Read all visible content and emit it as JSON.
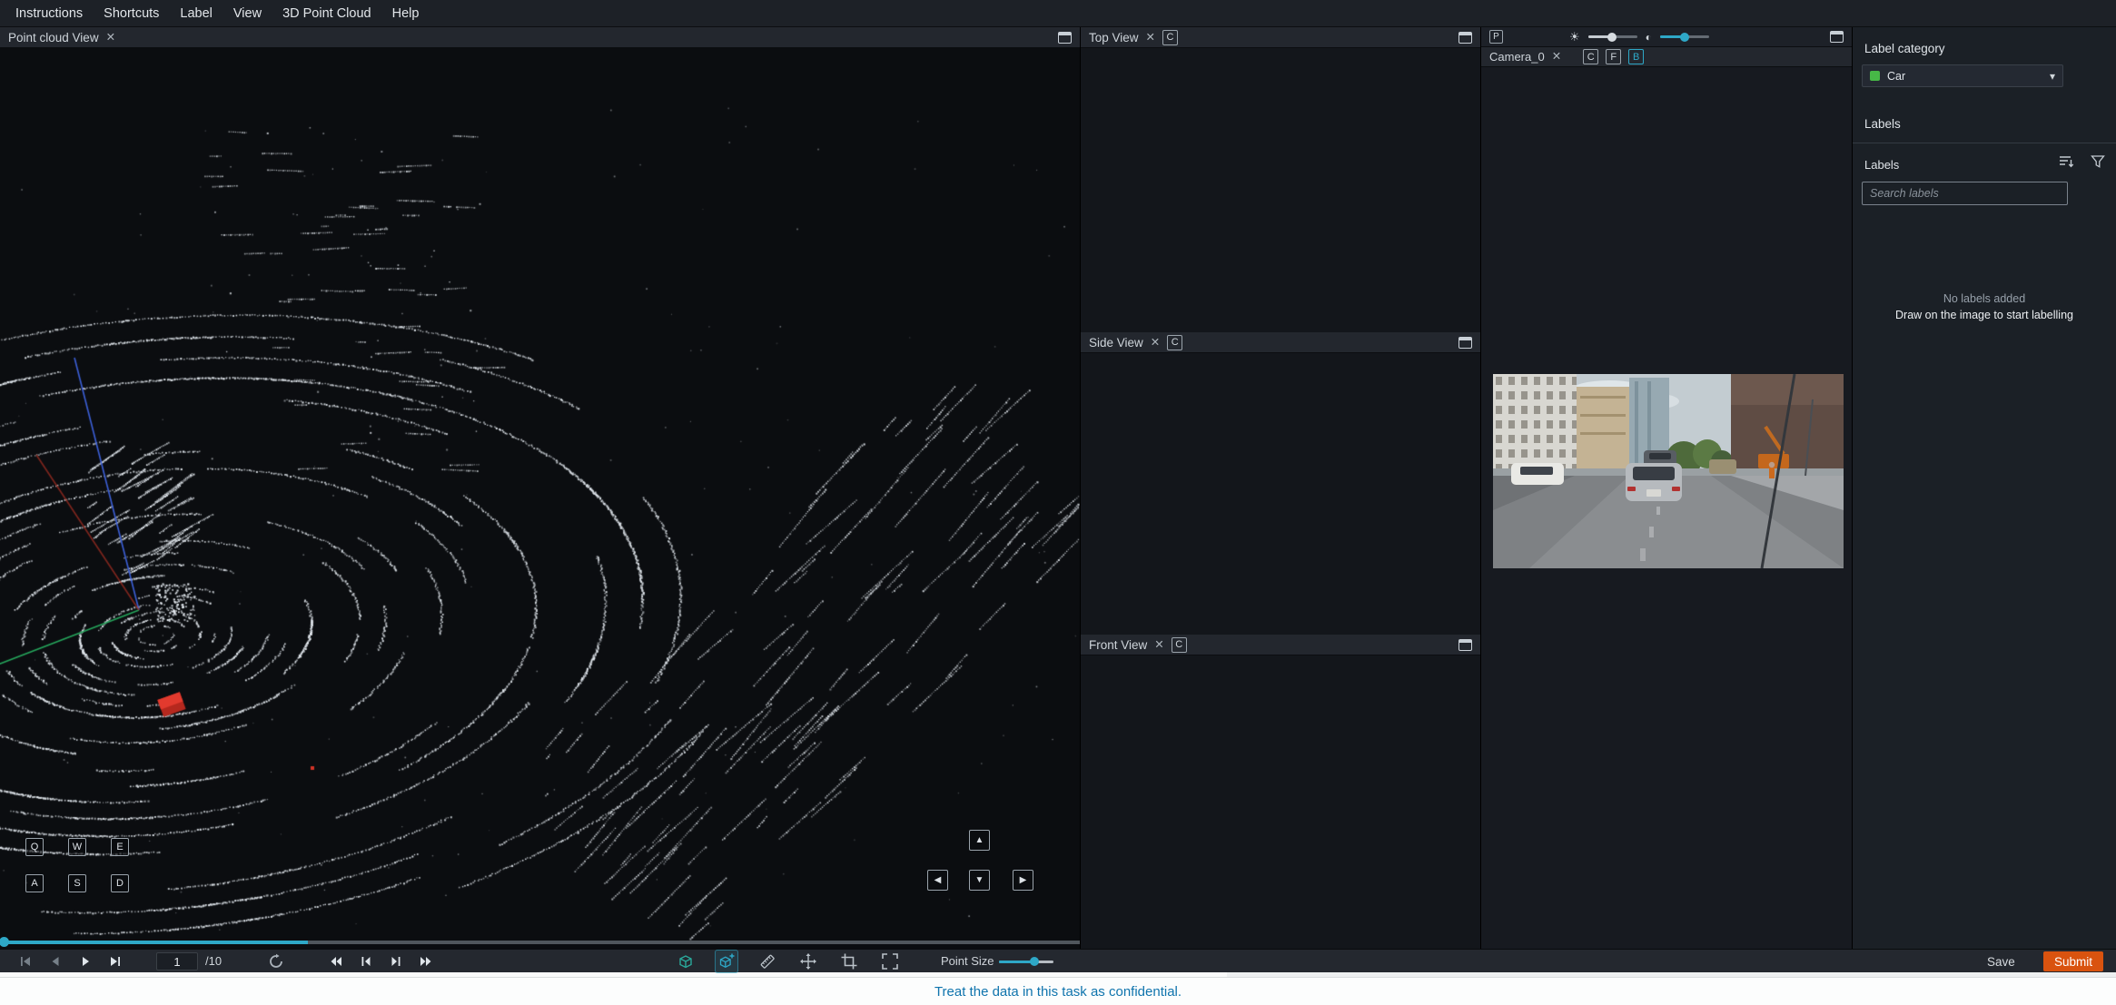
{
  "menu": {
    "items": [
      "Instructions",
      "Shortcuts",
      "Label",
      "View",
      "3D Point Cloud",
      "Help"
    ]
  },
  "icons": {
    "close": "✕",
    "chevron_down": "▾",
    "brightness": "☀",
    "contrast": "◐",
    "arrow_up": "▲",
    "arrow_down": "▼",
    "arrow_left": "◀",
    "arrow_right": "▶"
  },
  "panels": {
    "point_cloud": {
      "title": "Point cloud View",
      "keys_top": [
        "Q",
        "W",
        "E"
      ],
      "keys_bottom": [
        "A",
        "S",
        "D"
      ]
    },
    "top_view": {
      "title": "Top View",
      "camera_button": "C"
    },
    "side_view": {
      "title": "Side View",
      "camera_button": "C"
    },
    "front_view": {
      "title": "Front View",
      "camera_button": "C"
    },
    "camera": {
      "title": "Camera_0",
      "projection_button": "P",
      "camera_button": "C",
      "front_button": "F",
      "bev_button": "B"
    }
  },
  "sidebar": {
    "label_category_title": "Label category",
    "category_value": "Car",
    "labels_heading": "Labels",
    "labels_subheading": "Labels",
    "search_placeholder": "Search labels",
    "empty_title": "No labels added",
    "empty_subtitle": "Draw on the image to start labelling"
  },
  "toolbar": {
    "frame_value": "1",
    "frame_total": "/10",
    "point_size_label": "Point Size",
    "save_label": "Save",
    "submit_label": "Submit"
  },
  "footer": {
    "message": "Treat the data in this task as confidential."
  },
  "colors": {
    "accent": "#2ea8c7",
    "submit_bg": "#d9530f",
    "category_swatch": "#47b847"
  }
}
